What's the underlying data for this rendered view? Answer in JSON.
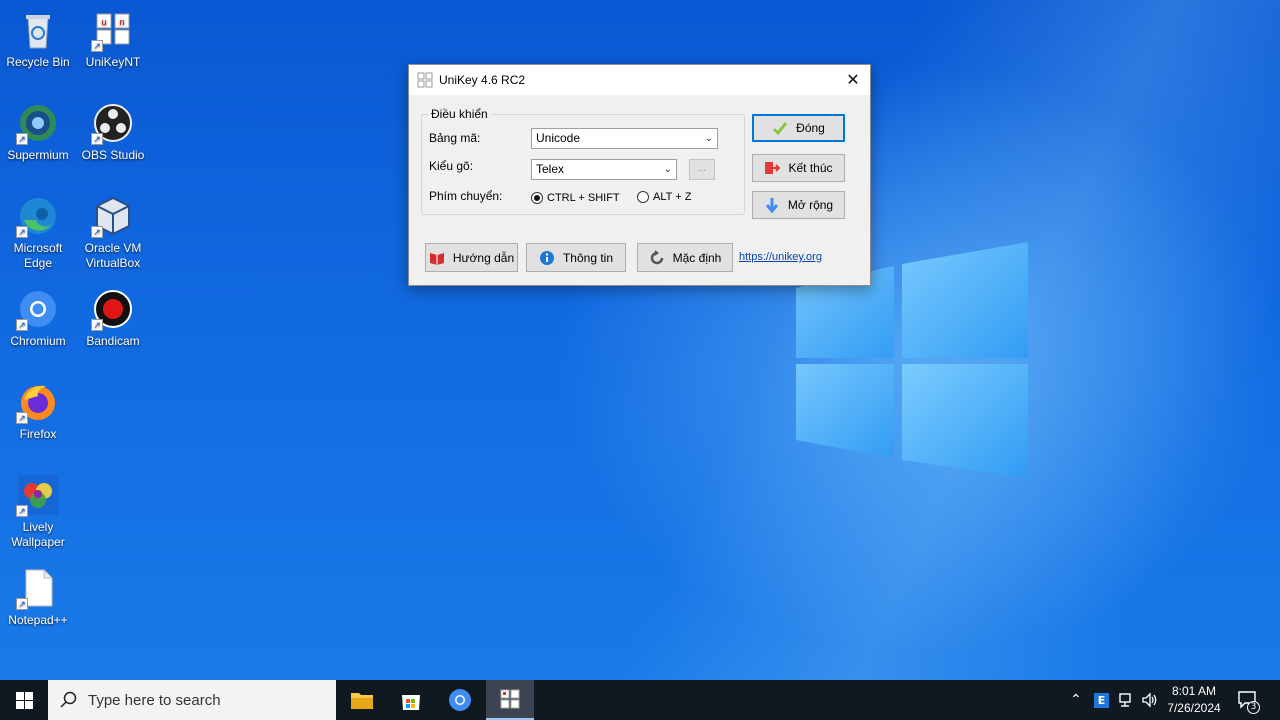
{
  "desktop_icons": [
    {
      "label": "Recycle Bin",
      "icon": "recycle-bin-icon"
    },
    {
      "label": "UniKeyNT",
      "icon": "unikey-icon"
    },
    {
      "label": "Supermium",
      "icon": "supermium-icon"
    },
    {
      "label": "OBS Studio",
      "icon": "obs-icon"
    },
    {
      "label": "Microsoft Edge",
      "icon": "edge-icon"
    },
    {
      "label": "Oracle VM VirtualBox",
      "icon": "virtualbox-icon"
    },
    {
      "label": "Chromium",
      "icon": "chromium-icon"
    },
    {
      "label": "Bandicam",
      "icon": "bandicam-icon"
    },
    {
      "label": "Firefox",
      "icon": "firefox-icon"
    },
    {
      "label": "Lively Wallpaper",
      "icon": "lively-wallpaper-icon"
    },
    {
      "label": "Notepad++",
      "icon": "notepad-icon"
    }
  ],
  "window": {
    "title": "UniKey 4.6 RC2",
    "group_title": "Điều khiển",
    "charset_label": "Bảng mã:",
    "charset_value": "Unicode",
    "input_method_label": "Kiểu gõ:",
    "input_method_value": "Telex",
    "more_button": "...",
    "switch_key_label": "Phím chuyển:",
    "switch_options": [
      "CTRL + SHIFT",
      "ALT + Z"
    ],
    "switch_selected": "CTRL + SHIFT",
    "buttons": {
      "close": "Đóng",
      "exit": "Kết thúc",
      "expand": "Mở rộng",
      "help": "Hướng dẫn",
      "info": "Thông tin",
      "default": "Mặc định"
    },
    "link": "https://unikey.org"
  },
  "taskbar": {
    "search_placeholder": "Type here to search",
    "apps": [
      "file-explorer",
      "microsoft-store",
      "chromium",
      "unikey"
    ],
    "active_app": "unikey",
    "time": "8:01 AM",
    "date": "7/26/2024",
    "input_indicator": "E",
    "notification_count": "3"
  },
  "colors": {
    "accent": "#0078d7",
    "link": "#0645ad",
    "taskbar": "#101820"
  }
}
